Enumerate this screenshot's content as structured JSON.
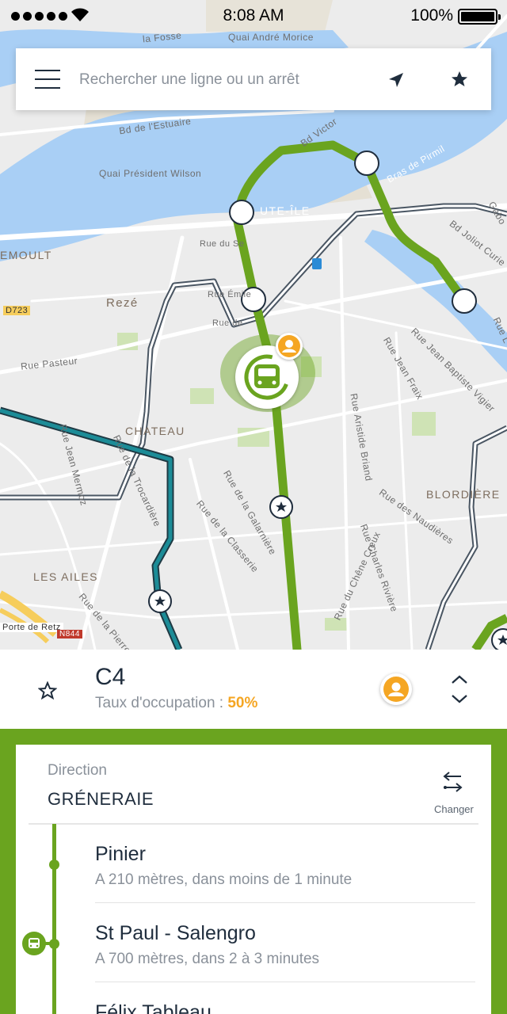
{
  "status_bar": {
    "time": "8:08 AM",
    "battery": "100%"
  },
  "search": {
    "placeholder": "Rechercher une ligne ou un arrêt",
    "menu_icon": "hamburger-menu-icon",
    "location_icon": "navigation-arrow-icon",
    "favorites_icon": "star-icon"
  },
  "map": {
    "labels": {
      "quai_andre_morice": "Quai André Morice",
      "fosse": "la Fosse",
      "estuaire": "Bd de l'Estuaire",
      "quai_wilson": "Quai Président Wilson",
      "victor": "Bd Victor",
      "bras_pirmil": "Bras de Pirmil",
      "ute_ile": "UTE-ÎLE",
      "emoult": "EMOULT",
      "reze": "Rezé",
      "d723": "D723",
      "rue_pasteur": "Rue Pasteur",
      "chateau": "CHATEAU",
      "bd_joliot": "Bd Joliot Curie",
      "rue_jean_fraix": "Rue Jean Fraix",
      "rue_jb_vigier": "Rue Jean Baptiste Vigier",
      "rue_aristide": "Rue Aristide Briand",
      "rue_naudieres": "Rue des Naudières",
      "blordiere": "BLORDIÈRE",
      "les_ailes": "LES AILES",
      "porte_retz": "Porte de Retz",
      "n844": "N844",
      "rue_galarniere": "Rue de la Galarnière",
      "rue_classerie": "Rue de la Classerie",
      "rue_chene_creux": "Rue du Chêne Creux",
      "rue_charles_riviere": "Rue Charles Rivière",
      "rue_jean_mermoz": "Rue Jean Mermoz",
      "rue_trocardiere": "Rue de la Trocardière",
      "rue_pierre": "Rue de la Pierre",
      "rue_emile": "Rue Émile",
      "rue_du_se": "Rue du Se",
      "rue_de": "Rue de",
      "gab": "Gabo",
      "rue_l": "Rue L"
    },
    "colors": {
      "line_green": "#6aa41f",
      "line_teal": "#1c8c97",
      "water": "#a9cff5",
      "accent_orange": "#f5a623"
    }
  },
  "line": {
    "name": "C4",
    "occupancy_label": "Taux d'occupation :",
    "occupancy_value": "50%",
    "favorite_icon": "star-outline-icon",
    "occupancy_icon": "person-icon",
    "expand_icon": "chevron-up-down-icon"
  },
  "direction": {
    "label": "Direction",
    "value": "GRÉNERAIE",
    "swap_icon": "swap-arrows-icon",
    "swap_label": "Changer"
  },
  "stops": [
    {
      "name": "Pinier",
      "info": "A 210 mètres, dans moins de 1 minute"
    },
    {
      "name": "St Paul - Salengro",
      "info": "A 700 mètres, dans 2 à 3 minutes"
    },
    {
      "name": "Félix Tableau",
      "info": ""
    }
  ]
}
